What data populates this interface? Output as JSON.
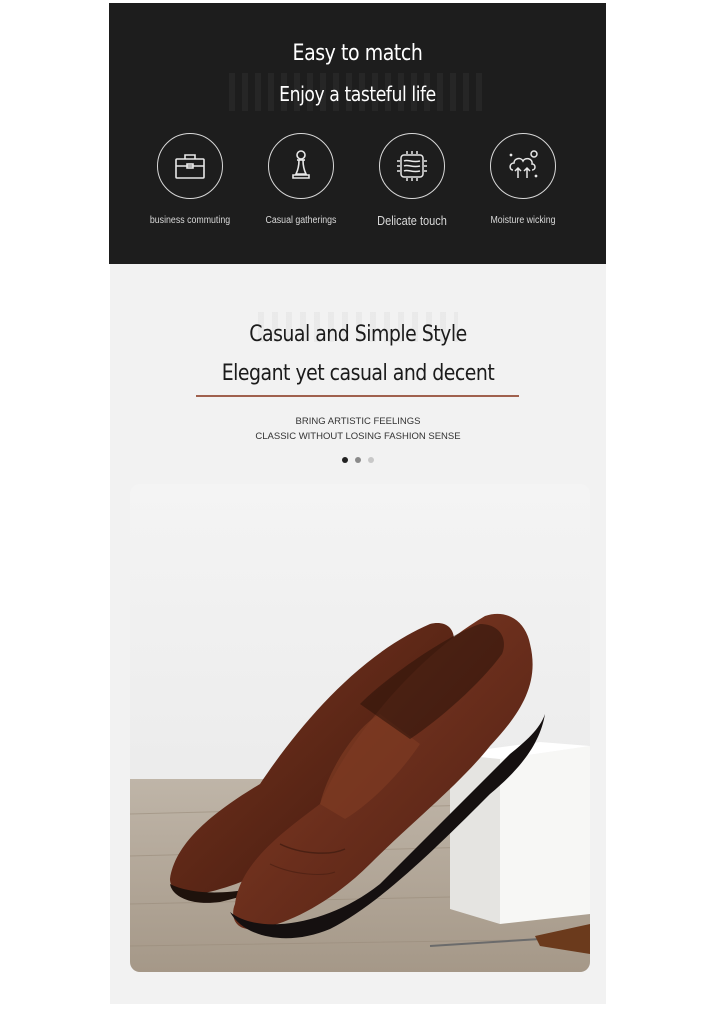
{
  "top": {
    "title": "Easy to match",
    "subtitle": "Enjoy a tasteful life",
    "features": [
      {
        "label": "business commuting",
        "icon": "briefcase-icon"
      },
      {
        "label": "Casual gatherings",
        "icon": "chess-pawn-icon"
      },
      {
        "label": "Delicate touch",
        "icon": "fabric-texture-icon"
      },
      {
        "label": "Moisture wicking",
        "icon": "breathable-cloud-icon"
      }
    ]
  },
  "section": {
    "title": "Casual and Simple Style",
    "subtitle": "Elegant yet casual and decent",
    "tagline_1": "BRING ARTISTIC FEELINGS",
    "tagline_2": "CLASSIC WITHOUT LOSING FASHION SENSE",
    "carousel": {
      "slides": 3,
      "active_index": 0
    }
  },
  "colors": {
    "top_background": "#1d1d1d",
    "section_background": "#f2f2f2",
    "accent_underline": "#a0614e",
    "shoe_leather": "#6a2e1c"
  }
}
